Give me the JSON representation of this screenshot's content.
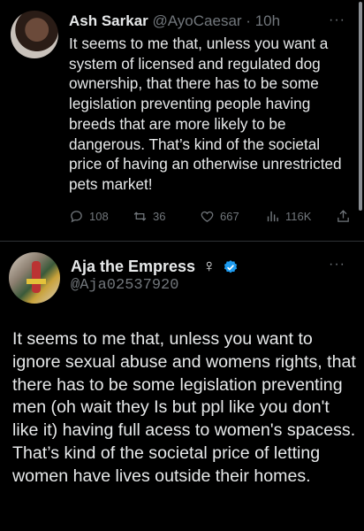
{
  "tweet1": {
    "name": "Ash Sarkar",
    "handle": "@AyoCaesar",
    "separator": "·",
    "time": "10h",
    "more": "···",
    "text": "It seems to me that, unless you want a system of licensed and regulated dog ownership, that there has to be some legislation preventing people having breeds that are more likely to be dangerous. That’s kind of the societal price of having an otherwise unrestricted pets market!",
    "replies": "108",
    "retweets": "36",
    "likes": "667",
    "views": "116K"
  },
  "tweet2": {
    "name": "Aja the Empress",
    "name_emoji": "♀",
    "handle": "@Aja02537920",
    "more": "···",
    "text": "It seems to me that, unless you want to ignore sexual abuse and womens rights, that there has to be some legislation preventing men (oh wait they Is but ppl like you don't like it) having full acess to women's spacess. That’s kind of the societal price of letting women have lives outside their homes."
  },
  "colors": {
    "background": "#000000",
    "text": "#e7e9ea",
    "secondary": "#71767b",
    "verified": "#1d9bf0",
    "divider": "#2f3336"
  }
}
